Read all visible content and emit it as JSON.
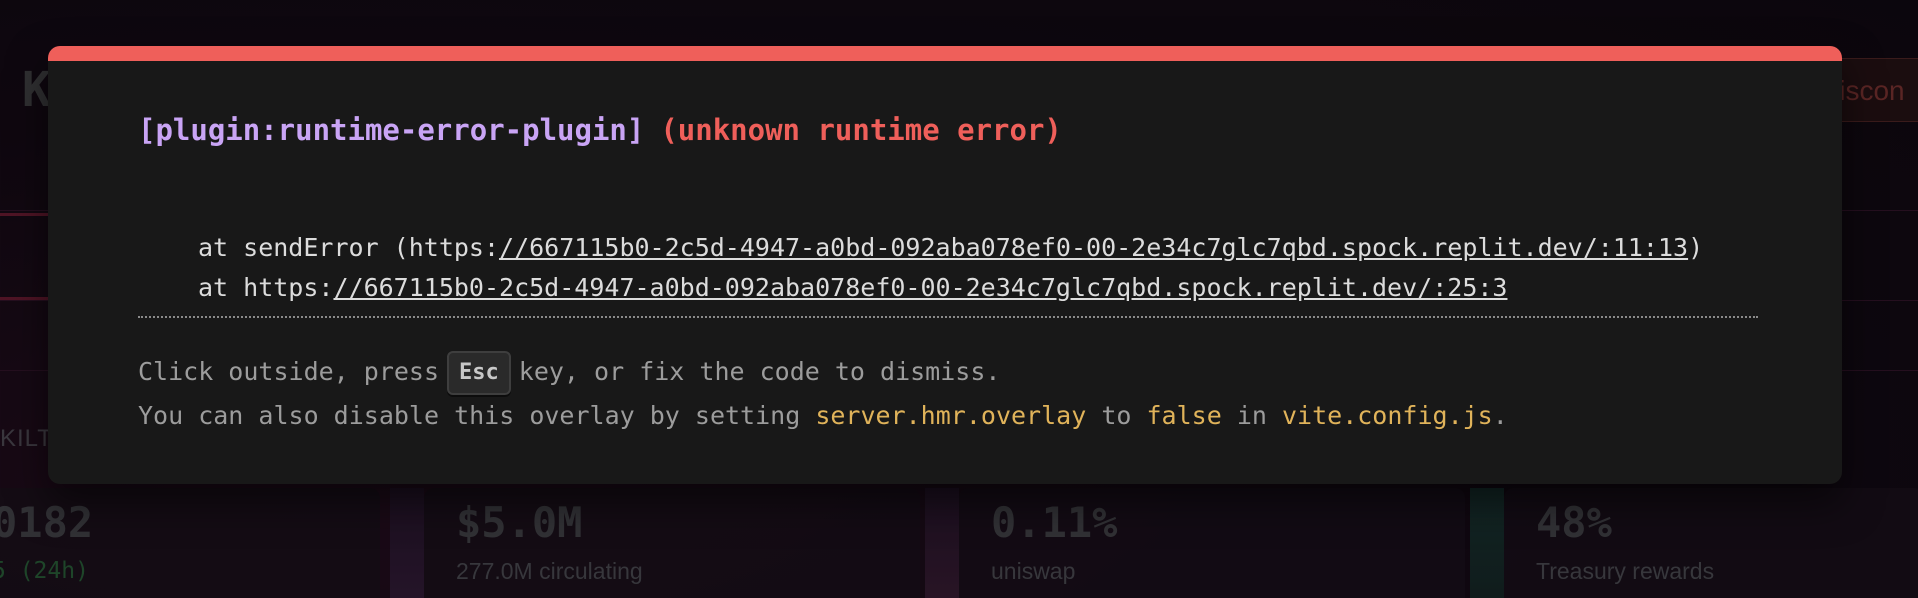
{
  "background": {
    "logo": "K",
    "disconnect_label": "Discon",
    "kilt_label": "KILT",
    "cards": [
      {
        "value": "0182",
        "sub": "5 (24h)"
      },
      {
        "value": "$5.0M",
        "sub": "277.0M circulating"
      },
      {
        "value": "0.11%",
        "sub": "uniswap"
      },
      {
        "value": "48%",
        "sub": "Treasury rewards"
      }
    ]
  },
  "overlay": {
    "accent_color": "#ef5f5a",
    "plugin": "[plugin:runtime-error-plugin]",
    "message": "(unknown runtime error)",
    "stack": {
      "line1_prefix": "at sendError (https:",
      "line1_link": "//667115b0-2c5d-4947-a0bd-092aba078ef0-00-2e34c7glc7qbd.spock.replit.dev/:11:13",
      "line1_suffix": ")",
      "line2_prefix": "at https:",
      "line2_link": "//667115b0-2c5d-4947-a0bd-092aba078ef0-00-2e34c7glc7qbd.spock.replit.dev/:25:3"
    },
    "tip1": {
      "before": "Click outside, press",
      "key": "Esc",
      "after": "key, or fix the code to dismiss."
    },
    "tip2": {
      "before": "You can also disable this overlay by setting",
      "setting": "server.hmr.overlay",
      "mid1": "to",
      "value": "false",
      "mid2": "in",
      "file": "vite.config.js",
      "end": "."
    }
  }
}
